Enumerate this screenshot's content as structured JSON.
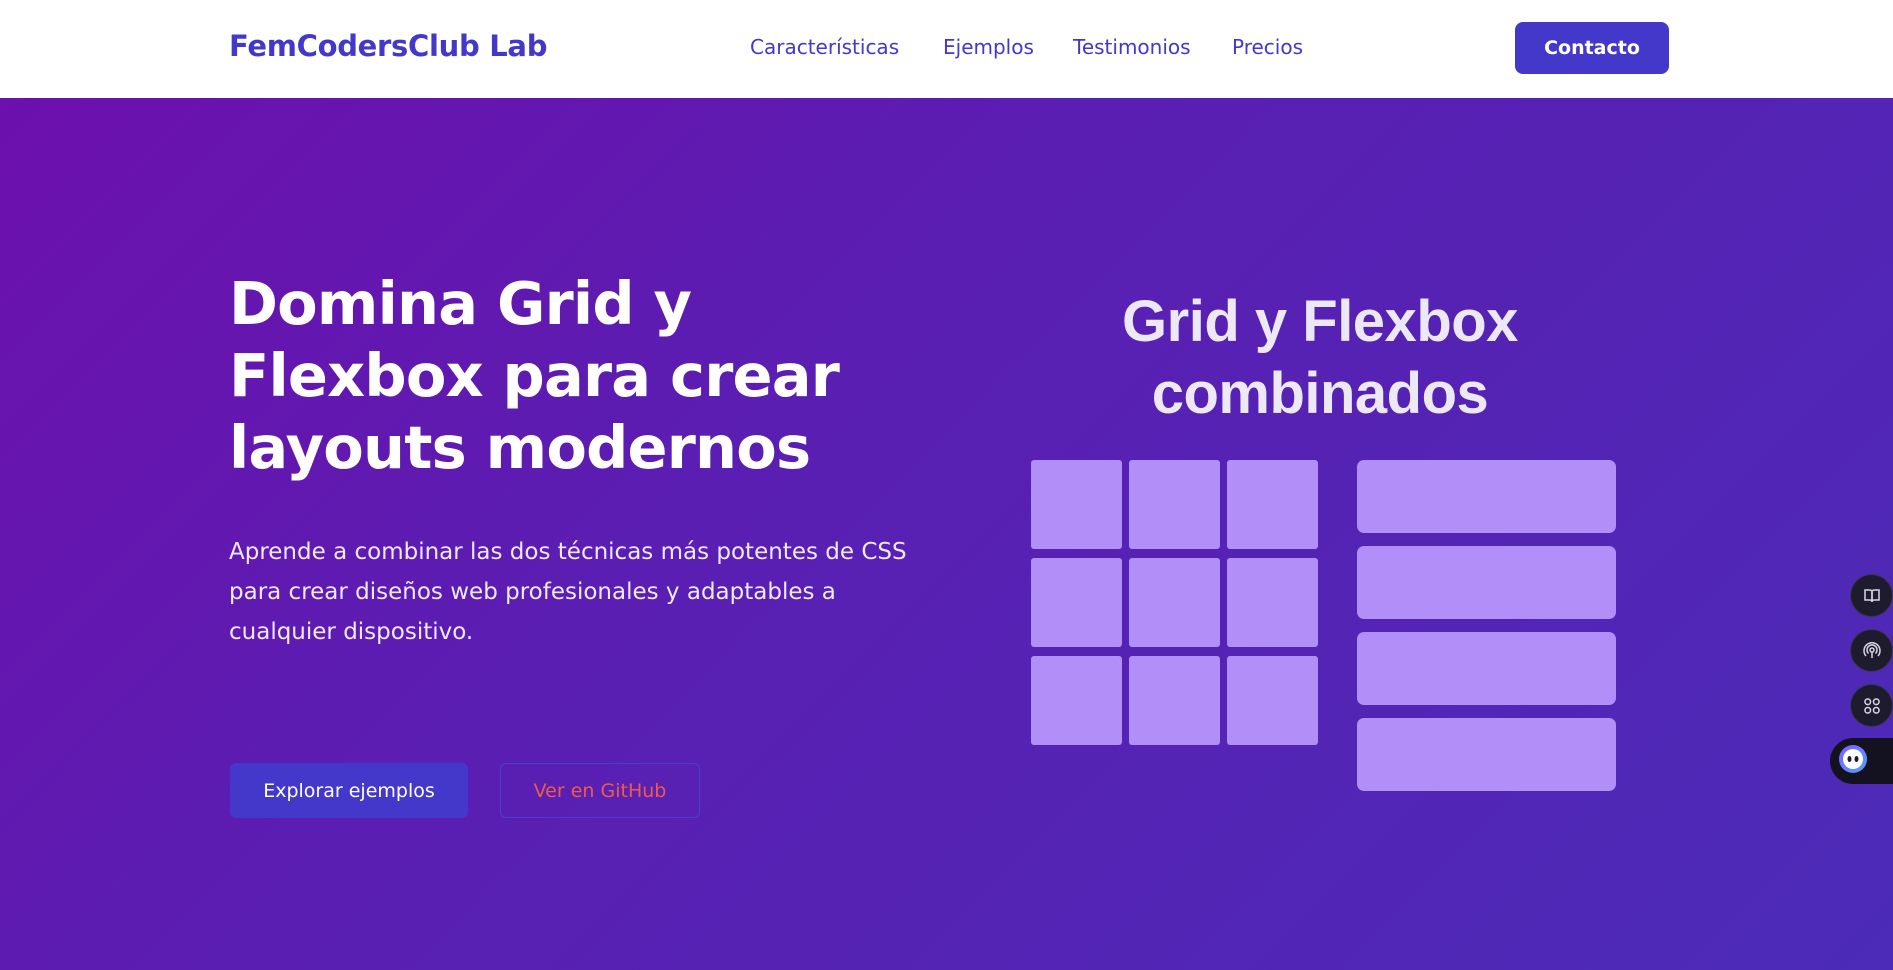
{
  "nav": {
    "logo": "FemCodersClub Lab",
    "links": [
      "Características",
      "Ejemplos",
      "Testimonios",
      "Precios"
    ],
    "contact_label": "Contacto"
  },
  "hero": {
    "title": "Domina Grid y Flexbox para crear layouts modernos",
    "subtitle": "Aprende a combinar las dos técnicas más potentes de CSS para crear diseños web profesionales y adaptables a cualquier dispositivo.",
    "primary_button": "Explorar ejemplos",
    "secondary_button": "Ver en GitHub"
  },
  "visual": {
    "title": "Grid y Flexbox combinados"
  },
  "side_dock": {
    "icons": [
      "book-icon",
      "broadcast-icon",
      "apps-grid-icon",
      "assistant-face-icon"
    ]
  },
  "colors": {
    "brand": "#4338ca",
    "hero_gradient_start": "#6d10ad",
    "hero_gradient_end": "#4c2bb8",
    "tile": "#b28ef9",
    "secondary_text": "#f05a4a"
  }
}
